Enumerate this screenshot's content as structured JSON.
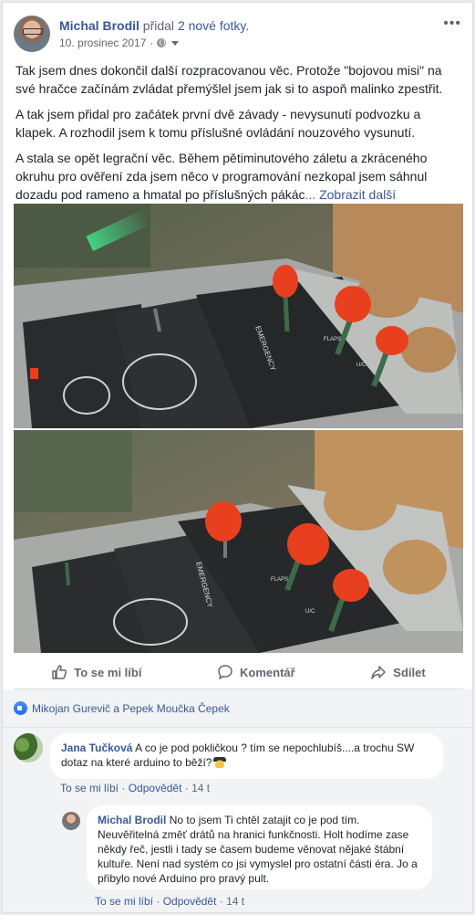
{
  "post": {
    "author": "Michal Brodil",
    "action_text": "přidal",
    "action_link": "2 nové fotky.",
    "date": "10. prosinec 2017",
    "more_label": "•••",
    "paragraphs": [
      "Tak jsem dnes dokončil další rozpracovanou věc. Protože \"bojovou misi\" na své hračce začínám zvládat přemýšlel jsem jak si to aspoň malinko zpestřit.",
      "A tak jsem přidal pro začátek první dvě závady - nevysunutí podvozku a klapek. A rozhodil jsem k tomu příslušné ovládání nouzového vysunutí.",
      "A stala se opět legrační věc. Během pětiminutového záletu a zkráceného okruhu pro ověření zda jsem něco v programování nezkopal jsem sáhnul dozadu pod rameno a hmatal po příslušných pákác"
    ],
    "see_more": "... Zobrazit další",
    "photo_labels": {
      "panel_text": "EMERGENCY",
      "flaps": "FLAPS",
      "uc": "U/C"
    }
  },
  "actions": {
    "like": "To se mi líbí",
    "comment": "Komentář",
    "share": "Sdílet"
  },
  "reactions": {
    "names": "Mikojan Gurevič a Pepek Moučka Čepek"
  },
  "comments": [
    {
      "author": "Jana Tučková",
      "text": "A co je pod pokličkou ? tím se nepochlubíš....a trochu SW dotaz na které arduino to běží?",
      "like": "To se mi líbí",
      "reply": "Odpovědět",
      "sep": "·",
      "time": "14 t"
    },
    {
      "author": "Michal Brodil",
      "text": "No to jsem Ti chtěl zatajit co je pod tím. Neuvěřitelná změť drátů na hranici funkčnosti. Holt hodíme zase někdy řeč, jestli i tady se časem budeme věnovat nějaké štábní kultuře. Není nad systém co jsi vymyslel pro ostatní části éra. Jo a přibylo nové Arduino pro pravý pult.",
      "like": "To se mi líbí",
      "reply": "Odpovědět",
      "sep": "·",
      "time": "14 t"
    }
  ],
  "colors": {
    "link": "#385898",
    "text": "#1d2129",
    "secondary": "#606770",
    "background": "#e9ebee",
    "knob_red": "#e8401e"
  }
}
